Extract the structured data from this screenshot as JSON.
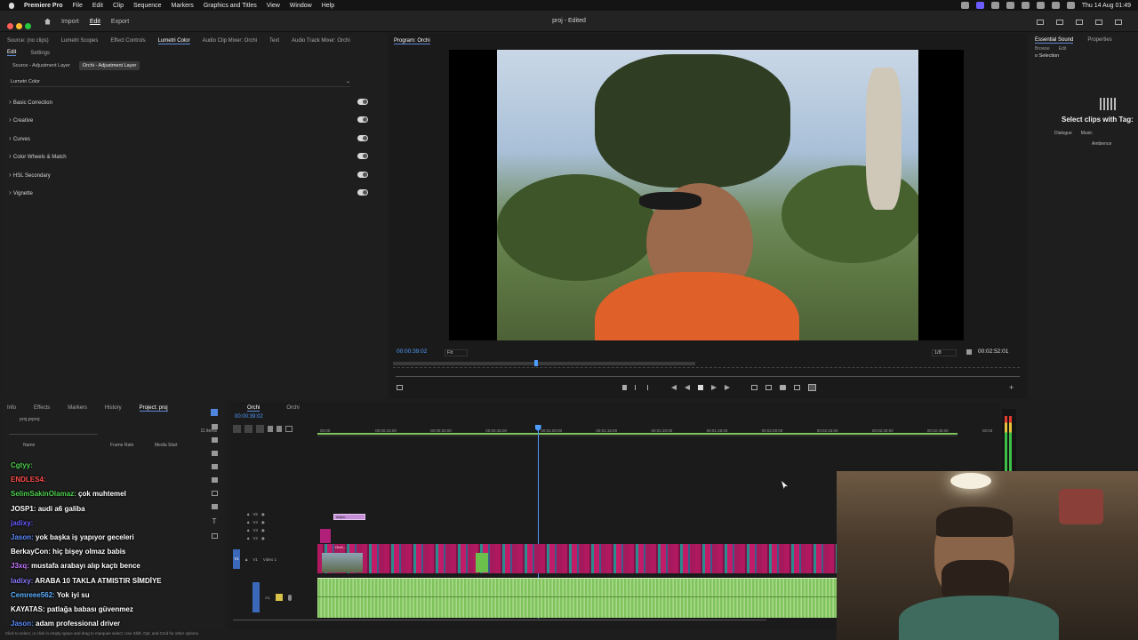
{
  "menubar": {
    "app": "Premiere Pro",
    "items": [
      "File",
      "Edit",
      "Clip",
      "Sequence",
      "Markers",
      "Graphics and Titles",
      "View",
      "Window",
      "Help"
    ],
    "clock": "Thu 14 Aug  01:49"
  },
  "header": {
    "tabs": [
      "Import",
      "Edit",
      "Export"
    ],
    "active_tab": "Edit",
    "title": "proj - Edited"
  },
  "effect_panel": {
    "tabs": [
      "Source: (no clips)",
      "Lumetri Scopes",
      "Effect Controls",
      "Lumetri Color",
      "Audio Clip Mixer: Orchi",
      "Text",
      "Audio Track Mixer: Orchi"
    ],
    "subtabs": [
      "Edit",
      "Settings"
    ],
    "source_chip": "Source - Adjustment Layer",
    "target_chip": "Orchi - Adjustment Layer",
    "effect_select": "Lumetri Color",
    "sections": [
      "Basic Correction",
      "Creative",
      "Curves",
      "Color Wheels & Match",
      "HSL Secondary",
      "Vignette"
    ]
  },
  "program": {
    "title": "Program: Orchi",
    "timecode": "00:00:39:02",
    "fit": "Fit",
    "resolution": "1/8",
    "duration": "00:02:52:01",
    "playhead_fraction": 0.226
  },
  "essential_sound": {
    "tabs": [
      "Essential Sound",
      "Properties"
    ],
    "subtabs": [
      "Browse",
      "Edit"
    ],
    "selection": "o Selection",
    "heading": "Select clips with Tag:",
    "tags": [
      "Dialogue",
      "Music",
      "Ambience"
    ]
  },
  "project_panel": {
    "tabs": [
      "Info",
      "Effects",
      "Markers",
      "History",
      "Project: proj"
    ],
    "file": "proj.prproj",
    "item_count": "11 items",
    "columns": [
      "Name",
      "Frame Rate",
      "Media Start"
    ]
  },
  "timeline": {
    "tabs": [
      "Orchi",
      "Orchi"
    ],
    "timecode": "00:00:39:02",
    "ruler": [
      "00:00",
      "00:00:15:00",
      "00:00:30:00",
      "00:00:45:00",
      "00:01:00:00",
      "00:01:15:00",
      "00:01:30:00",
      "00:01:45:00",
      "00:02:00:00",
      "00:02:15:00",
      "00:02:30:00",
      "00:02:45:00",
      "00:03"
    ],
    "tracks": [
      "V5",
      "V4",
      "V3",
      "V2",
      "V1",
      "A1"
    ],
    "video1_label": "Video 1",
    "adjustment_clip": "Adjus...",
    "clip_label": "Orch...",
    "playhead_fraction": 0.41
  },
  "chat": [
    {
      "user": "Cgtyy",
      "text": "",
      "color": "#4fd14f"
    },
    {
      "user": "ENDLES4",
      "text": "",
      "color": "#ff4d4d"
    },
    {
      "user": "SelimSakinOlamaz",
      "text": "çok muhtemel",
      "color": "#4fd14f"
    },
    {
      "user": "JOSP1",
      "text": "audi a6 galiba",
      "color": "#ffffff"
    },
    {
      "user": "jadixy",
      "text": "",
      "color": "#6a5cff"
    },
    {
      "user": "Jason",
      "text": "yok başka iş yapıyor geceleri",
      "color": "#5b8cff"
    },
    {
      "user": "BerkayCon",
      "text": "hiç bişey olmaz babis",
      "color": "#ffffff"
    },
    {
      "user": "J3xq",
      "text": "mustafa arabayı alıp kaçtı bence",
      "color": "#c878ff"
    },
    {
      "user": "ladixy",
      "text": "ARABA 10 TAKLA ATMISTIR SİMDİYE",
      "color": "#8a7cff"
    },
    {
      "user": "Cemreee562",
      "text": "Yok iyi su",
      "color": "#5bb0ff"
    },
    {
      "user": "KAYATAS",
      "text": "patlağa babası güvenmez",
      "color": "#ffffff"
    },
    {
      "user": "Jason",
      "text": "adam professional driver",
      "color": "#5b8cff"
    }
  ],
  "status_bar": "Click to select, or click in empty space and drag to marquee select. Use Shift, Opt, and Cmd for other options.",
  "colors": {
    "accent": "#5e8bd6",
    "timecode": "#4f9cff",
    "clip_magenta": "#c0186a",
    "clip_teal": "#2a8c8c",
    "audio_green": "#8fcf6a"
  }
}
